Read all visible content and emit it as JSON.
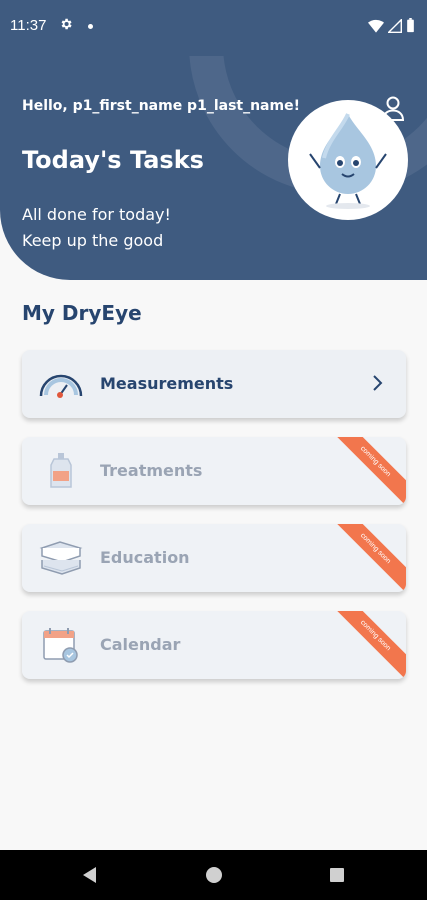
{
  "status_bar": {
    "time": "11:37"
  },
  "header": {
    "greeting": "Hello, p1_first_name p1_last_name!",
    "title": "Today's Tasks",
    "message_line1": "All done for today!",
    "message_line2": "Keep up the good"
  },
  "section": {
    "title": "My DryEye"
  },
  "cards": [
    {
      "label": "Measurements",
      "icon": "gauge-icon",
      "badge": ""
    },
    {
      "label": "Treatments",
      "icon": "eye-drops-icon",
      "badge": "coming soon"
    },
    {
      "label": "Education",
      "icon": "books-icon",
      "badge": "coming soon"
    },
    {
      "label": "Calendar",
      "icon": "calendar-icon",
      "badge": "coming soon"
    }
  ],
  "colors": {
    "header_bg": "#3f5b80",
    "accent_dark": "#27456f",
    "ribbon": "#f2764d",
    "card_bg": "#eff2f6"
  }
}
